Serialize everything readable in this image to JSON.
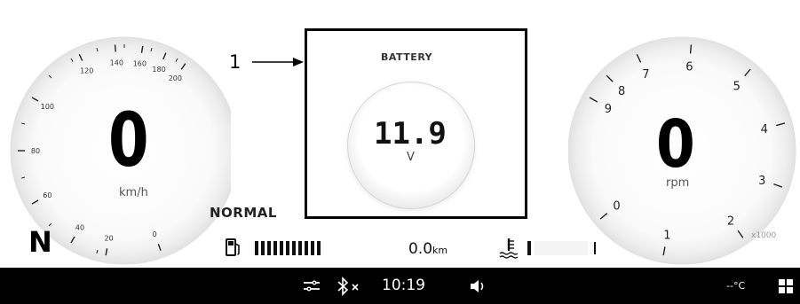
{
  "speedometer": {
    "value": "0",
    "unit": "km/h",
    "ticks": [
      "40",
      "20",
      "0",
      "60",
      "80",
      "100",
      "120",
      "140",
      "160",
      "180",
      "200"
    ]
  },
  "tachometer": {
    "value": "0",
    "unit": "rpm",
    "multiplier": "x1000",
    "ticks": [
      "0",
      "1",
      "2",
      "3",
      "4",
      "5",
      "6",
      "7",
      "8",
      "9"
    ]
  },
  "battery": {
    "title": "BATTERY",
    "value": "11.9",
    "unit": "V"
  },
  "callout": {
    "number": "1"
  },
  "riding_mode": "NORMAL",
  "gear": "N",
  "fuel": {
    "icon": "fuel-pump-icon"
  },
  "trip": {
    "value": "0.0",
    "unit": "km"
  },
  "coolant": {
    "icon": "coolant-temperature-icon"
  },
  "statusbar": {
    "time": "10:19",
    "temperature": "--°C",
    "icons": [
      "handlebar-heater-icon",
      "bluetooth-off-icon",
      "volume-icon",
      "menu-grid-icon"
    ]
  }
}
